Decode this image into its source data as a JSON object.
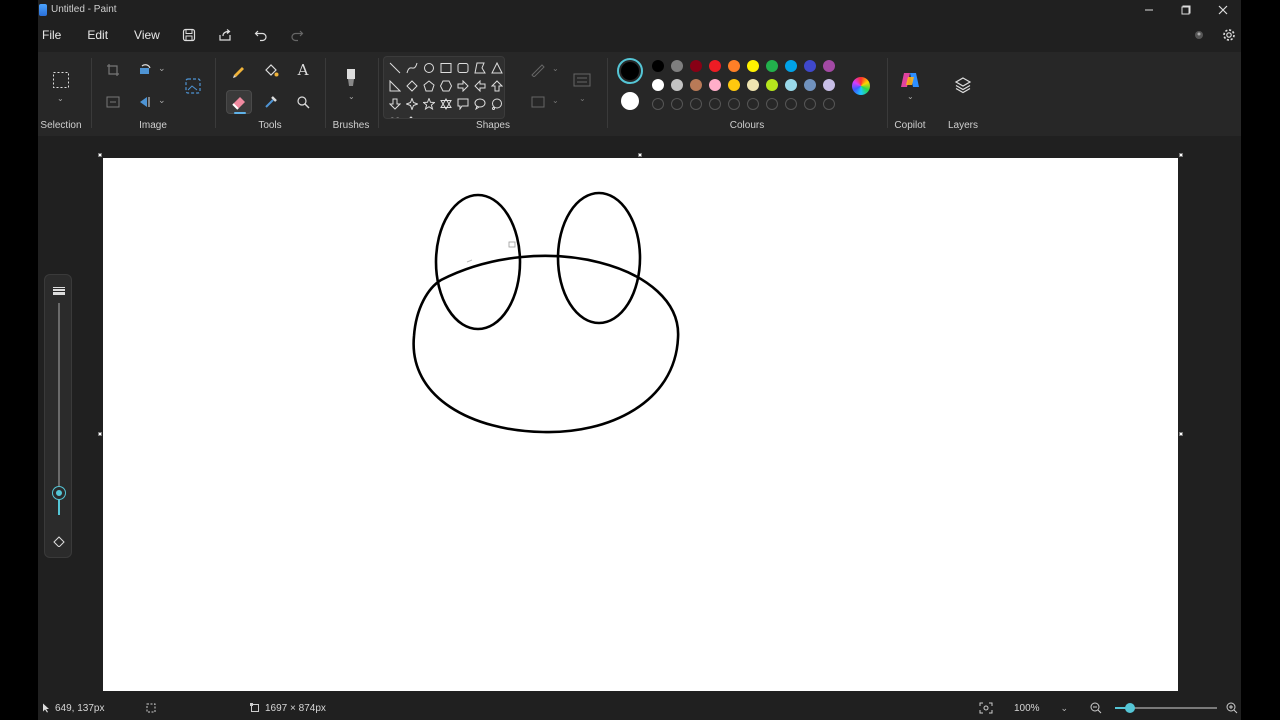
{
  "window": {
    "title": "Untitled - Paint",
    "controls": [
      "minimize-icon",
      "maximize-icon",
      "close-icon"
    ]
  },
  "menu": {
    "items": [
      "File",
      "Edit",
      "View"
    ],
    "quick_actions": [
      "save-icon",
      "share-icon",
      "undo-icon",
      "redo-icon"
    ]
  },
  "ribbon": {
    "groups": {
      "selection": "Selection",
      "image": "Image",
      "tools": "Tools",
      "brushes": "Brushes",
      "shapes": "Shapes",
      "colours": "Colours",
      "copilot": "Copilot",
      "layers": "Layers"
    },
    "active_tool": "eraser",
    "colours": {
      "primary": "#000000",
      "secondary": "#ffffff",
      "row1": [
        "#000000",
        "#7f7f7f",
        "#880015",
        "#ed1c24",
        "#ff7f27",
        "#fff200",
        "#22b14c",
        "#00a2e8",
        "#3f48cc",
        "#a349a4"
      ],
      "row2": [
        "#ffffff",
        "#c3c3c3",
        "#b97a57",
        "#ffaec9",
        "#ffc90e",
        "#efe4b0",
        "#b5e61d",
        "#99d9ea",
        "#7092be",
        "#c8bfe7"
      ],
      "row3_count": 10
    }
  },
  "status": {
    "cursor_position": "649, 137px",
    "canvas_size": "1697 × 874px",
    "zoom": "100%"
  },
  "tool_size": 0.15
}
